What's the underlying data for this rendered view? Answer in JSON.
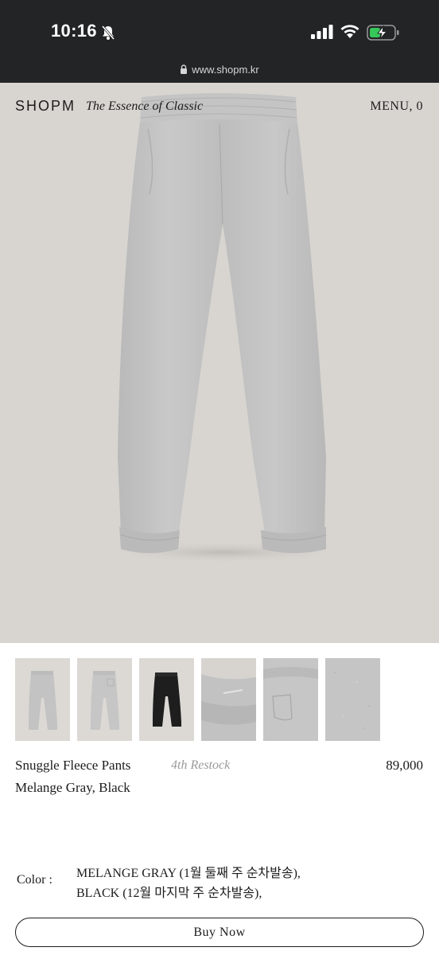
{
  "status_bar": {
    "time": "10:16"
  },
  "browser": {
    "url": "www.shopm.kr"
  },
  "header": {
    "brand": "SHOPM",
    "tagline": "The Essence of Classic",
    "menu_label": "MENU, 0"
  },
  "colors": {
    "status_bar_bg": "#232426",
    "hero_bg": "#d8d5d1",
    "melange_gray": "#c2c2c2",
    "black_variant": "#1e1e1e",
    "restock_text": "#9a9a9a",
    "battery_fill": "#36c759"
  },
  "thumbnails": [
    {
      "name": "thumb-front-gray",
      "icon": "pants-front"
    },
    {
      "name": "thumb-back-gray",
      "icon": "pants-back"
    },
    {
      "name": "thumb-front-black",
      "icon": "pants-front"
    },
    {
      "name": "thumb-cuff-detail",
      "icon": "cuff-detail"
    },
    {
      "name": "thumb-pocket-detail",
      "icon": "pocket-detail"
    },
    {
      "name": "thumb-fabric-detail",
      "icon": "fabric-texture"
    }
  ],
  "product": {
    "name": "Snuggle Fleece Pants",
    "variants": "Melange Gray, Black",
    "restock": "4th Restock",
    "price": "89,000"
  },
  "color_option": {
    "label": "Color :",
    "line1": "MELANGE GRAY (1월 둘째 주 순차발송),",
    "line2": "BLACK (12월 마지막 주 순차발송),"
  },
  "buy_button": {
    "label": "Buy Now"
  }
}
